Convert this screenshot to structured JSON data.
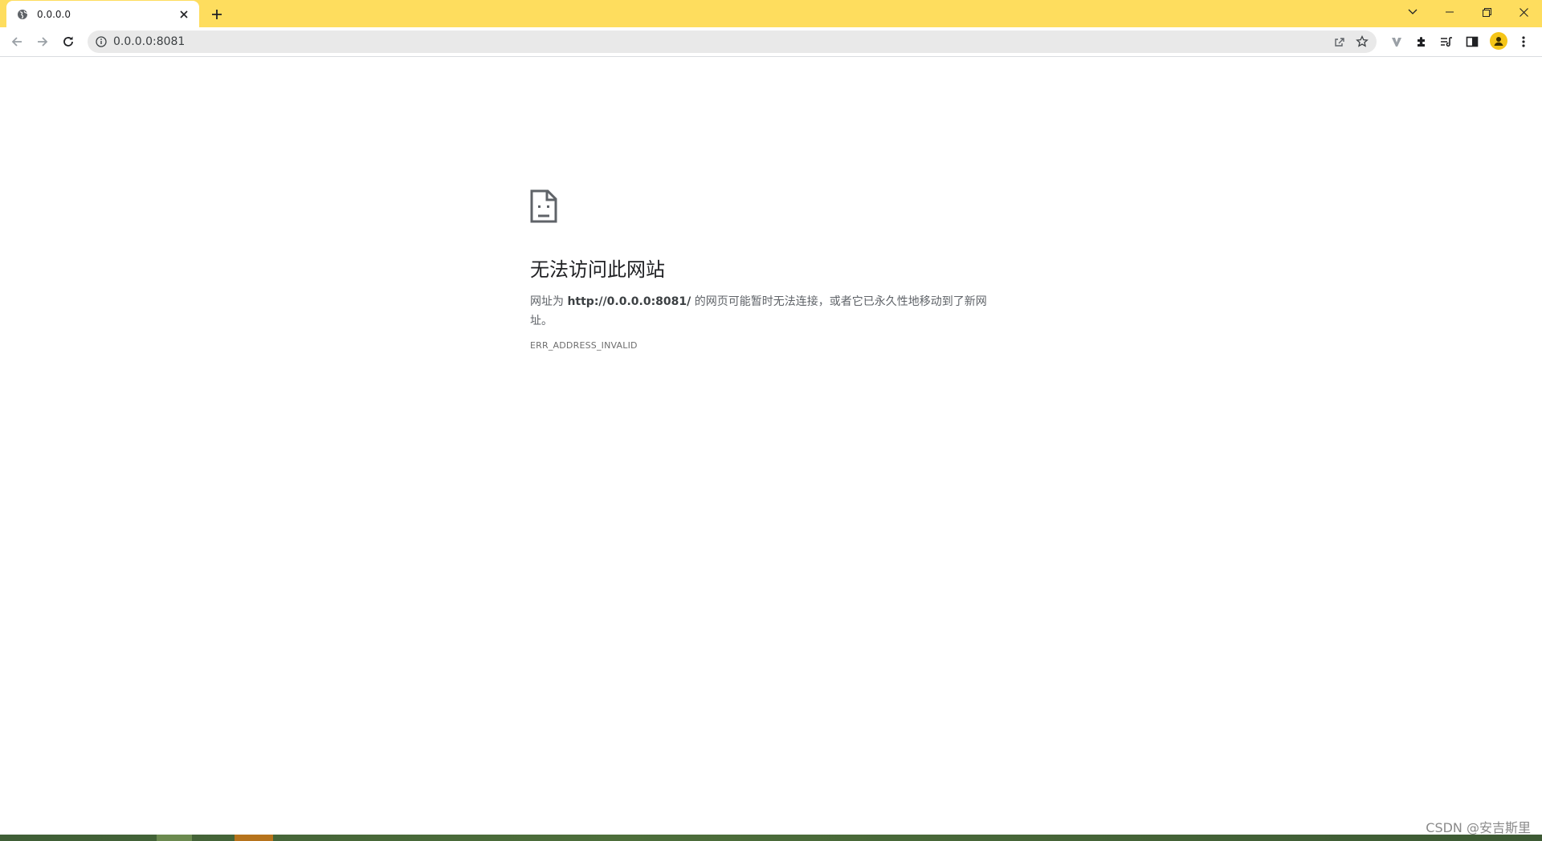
{
  "browser": {
    "tab_title": "0.0.0.0",
    "address": "0.0.0.0:8081",
    "theme_color": "#fedd5e"
  },
  "icons": {
    "favicon": "globe-icon",
    "tab_close": "close-icon",
    "new_tab": "plus-icon",
    "back": "arrow-left-icon",
    "forward": "arrow-right-icon",
    "reload": "reload-icon",
    "site_info": "info-icon",
    "share": "share-icon",
    "bookmark": "star-icon",
    "extensions": [
      "vivaldi-v-icon",
      "puzzle-icon",
      "reading-list-icon",
      "side-panel-icon"
    ],
    "profile": "avatar-icon",
    "menu": "kebab-menu-icon"
  },
  "error": {
    "heading": "无法访问此网站",
    "summary_prefix": "网址为 ",
    "summary_url": "http://0.0.0.0:8081/",
    "summary_suffix": " 的网页可能暂时无法连接，或者它已永久性地移动到了新网址。",
    "code": "ERR_ADDRESS_INVALID"
  },
  "watermark": "CSDN @安吉斯里"
}
